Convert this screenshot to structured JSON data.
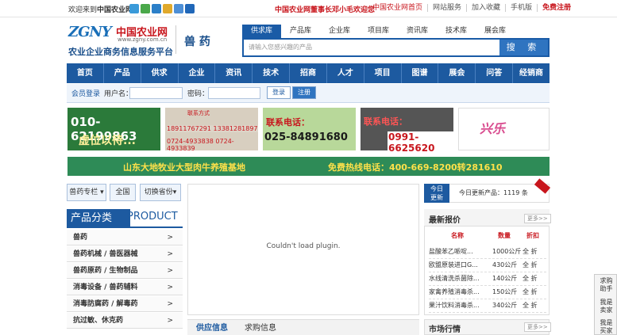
{
  "topbar": {
    "welcome_prefix": "欢迎来到",
    "welcome_site": "中国农业网",
    "announcement": "中国农业网董事长邓小毛欢迎您",
    "links": [
      "中国农业网首页",
      "网站服务",
      "加入收藏",
      "手机版",
      "免费注册"
    ]
  },
  "logo": {
    "mark": "ZGNY",
    "cn_name": "中国农业网",
    "url": "www.zgny.com.cn",
    "slogan": "农业企业商务信息服务平台"
  },
  "section_title": "兽 药",
  "search": {
    "tabs": [
      "供求库",
      "产品库",
      "企业库",
      "项目库",
      "资讯库",
      "技术库",
      "展会库"
    ],
    "active_tab": "供求库",
    "placeholder": "请输入您感兴趣的产品",
    "button": "搜 索"
  },
  "nav": [
    "首页",
    "产品",
    "供求",
    "企业",
    "资讯",
    "技术",
    "招商",
    "人才",
    "项目",
    "图谱",
    "展会",
    "问答",
    "经销商"
  ],
  "login": {
    "title": "会员登录",
    "user_label": "用户名：",
    "pass_label": "密码：",
    "login_btn": "登录",
    "register_btn": "注册"
  },
  "ads": {
    "ad1_phone": "010-62199863",
    "ad1_text": "虚位以待...",
    "ad2_title": "联系方式",
    "ad2_line1": "18911767291 13381281897",
    "ad2_line2": "0724-4933838 0724-4933839",
    "ad3_label": "联系电话：",
    "ad3_phone": "025-84891680",
    "ad4_label": "联系电话：",
    "ad4_phone": "0991-6625620",
    "ad5_brand": "兴乐"
  },
  "banner": {
    "left": "山东大地牧业大型肉牛养殖基地",
    "right": "免费热线电话：400-669-8200转281610"
  },
  "left_filters": {
    "column": "兽药专栏",
    "region": "全国",
    "switch": "切换省份"
  },
  "categories": {
    "title_cn": "产品分类",
    "title_en": "PRODUCT",
    "items": [
      "兽药",
      "兽药机械 / 兽医器械",
      "兽药原药 / 生物制品",
      "消毒设备 / 兽药辅料",
      "消毒防腐药 / 解毒药",
      "抗过敏、休克药"
    ],
    "arrow": ">"
  },
  "plugin_message": "Couldn't load plugin.",
  "info_tabs": [
    "供应信息",
    "求购信息"
  ],
  "today": {
    "label_top": "今日",
    "label_bottom": "更新",
    "text": "今日更新产品：1119 条"
  },
  "quotes": {
    "title": "最新报价",
    "more": "更多>>",
    "headers": [
      "名称",
      "数量",
      "折扣"
    ],
    "rows": [
      {
        "name": "盐酸苯乙哌啶...",
        "qty": "1000公斤",
        "discount": "全 折"
      },
      {
        "name": "欧盟原装进口G...",
        "qty": "430公斤",
        "discount": "全 折"
      },
      {
        "name": "水线清洗杀菌除...",
        "qty": "140公斤",
        "discount": "全 折"
      },
      {
        "name": "家禽养殖消毒杀...",
        "qty": "150公斤",
        "discount": "全 折"
      },
      {
        "name": "果汁饮料消毒杀...",
        "qty": "340公斤",
        "discount": "全 折"
      }
    ]
  },
  "market": {
    "title": "市场行情",
    "more": "更多>>"
  },
  "float_panel": [
    "求购",
    "助手",
    "我是",
    "卖家",
    "我是",
    "买家"
  ],
  "colors": {
    "primary": "#1d5aa0",
    "red": "#c8161d"
  }
}
